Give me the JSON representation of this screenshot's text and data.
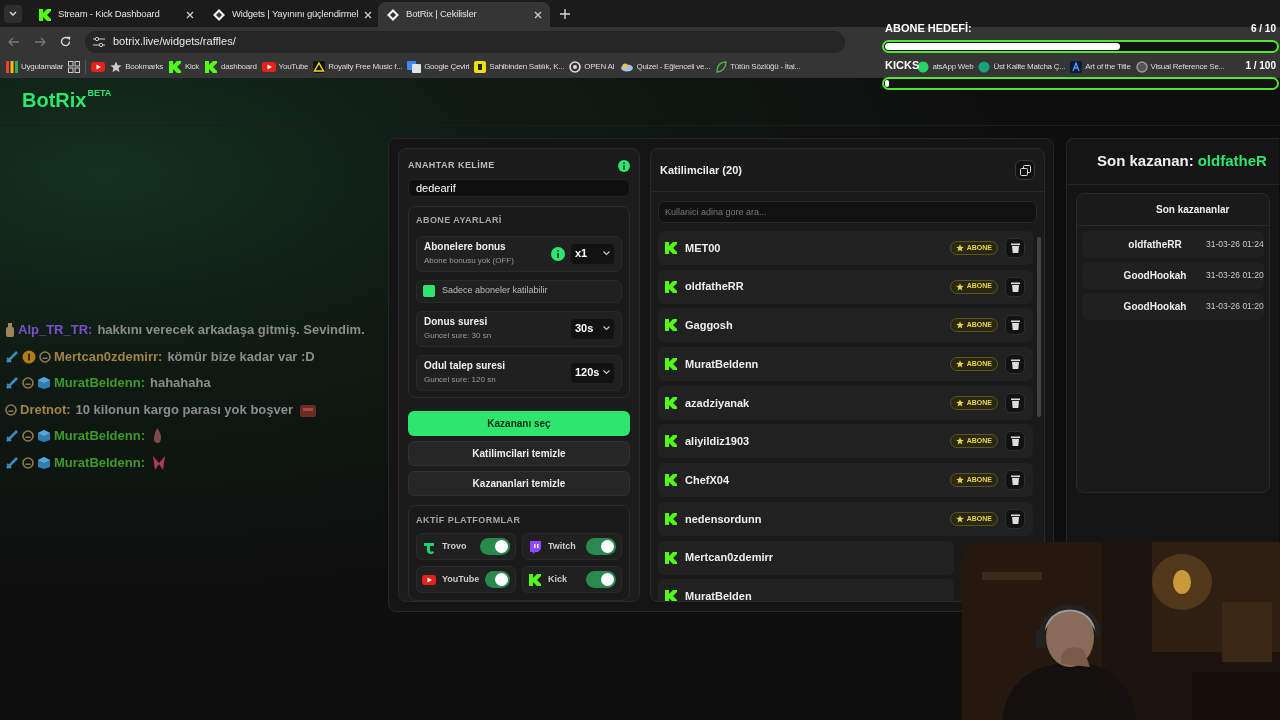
{
  "browser": {
    "tabs": [
      {
        "title": "Stream - Kick Dashboard",
        "kind": "kick",
        "selected": false
      },
      {
        "title": "Widgets | Yayınını güçlendirmel",
        "kind": "botrix",
        "selected": false
      },
      {
        "title": "BotRix | Cekilisler",
        "kind": "botrix",
        "selected": true
      }
    ],
    "url": "botrix.live/widgets/raffles/",
    "bookmarks": [
      {
        "kind": "apps",
        "label": "Uygulamalar"
      },
      {
        "kind": "grid"
      },
      {
        "kind": "youtube"
      },
      {
        "kind": "star",
        "label": "Bookmarks"
      },
      {
        "kind": "kick",
        "label": "Kick"
      },
      {
        "kind": "kick",
        "label": "dashboard"
      },
      {
        "kind": "youtube",
        "label": "YouTube"
      },
      {
        "kind": "triangle",
        "label": "Royalty Free Music f..."
      },
      {
        "kind": "translate",
        "label": "Google Çeviri"
      },
      {
        "kind": "square",
        "label": "Sahibinden Satılık, K..."
      },
      {
        "kind": "openai",
        "label": "OPEN AI"
      },
      {
        "kind": "quiz",
        "label": "Quizei - Eğlenceli ve..."
      },
      {
        "kind": "leaf",
        "label": "Tütün Sözlüğü - İtal..."
      },
      {
        "kind": "chat",
        "label": "atsApp Web"
      },
      {
        "kind": "dot",
        "label": "Üst Kalite Matcha Ç..."
      },
      {
        "kind": "art",
        "label": "Art of the Title"
      },
      {
        "kind": "ring",
        "label": "Visual Reference Se..."
      }
    ]
  },
  "goals": [
    {
      "title": "ABONE HEDEFİ:",
      "count": "6 / 10",
      "level": 0.6
    },
    {
      "title": "KICKS",
      "count": "1 / 100",
      "level": 0.01
    }
  ],
  "logo": {
    "text": "BotRix",
    "badge": "BETA"
  },
  "chat": [
    {
      "user": "Alp_TR_TR:",
      "color": "#7a52cc",
      "badges": [
        {
          "kind": "bottle"
        }
      ],
      "text": "hakkını verecek arkadaşa gitmiş. Sevindim."
    },
    {
      "user": "Mertcan0zdemirr:",
      "color": "#a08446",
      "badges": [
        {
          "kind": "sword"
        },
        {
          "kind": "coin"
        },
        {
          "kind": "face"
        }
      ],
      "text": "kömür bize kadar var :D"
    },
    {
      "user": "MuratBeldenn:",
      "color": "#3d9b2a",
      "badges": [
        {
          "kind": "sword"
        },
        {
          "kind": "face"
        },
        {
          "kind": "cube"
        }
      ],
      "text": "hahahaha"
    },
    {
      "user": "Dretnot:",
      "color": "#a08446",
      "badges": [
        {
          "kind": "face"
        }
      ],
      "text": "10 kilonun kargo parası yok boşver",
      "emotes": [
        {
          "kind": "box"
        }
      ]
    },
    {
      "user": "MuratBeldenn:",
      "color": "#3d9b2a",
      "badges": [
        {
          "kind": "sword"
        },
        {
          "kind": "face"
        },
        {
          "kind": "cube"
        }
      ],
      "emotes": [
        {
          "kind": "drop"
        }
      ]
    },
    {
      "user": "MuratBeldenn:",
      "color": "#3d9b2a",
      "badges": [
        {
          "kind": "sword"
        },
        {
          "kind": "face"
        },
        {
          "kind": "cube"
        }
      ],
      "emotes": [
        {
          "kind": "bow"
        }
      ]
    }
  ],
  "raffle": {
    "keyword_label": "ANAHTAR KELİME",
    "keyword": "dedearif",
    "sub_title": "ABONE AYARLARİ",
    "settings": [
      {
        "kind": "select",
        "title": "Abonelere bonus",
        "hint": "Abone bonusu yok (OFF)",
        "info": true,
        "value": "x1"
      },
      {
        "kind": "checkbox",
        "label": "Sadece aboneler katilabilir",
        "checked": true
      },
      {
        "kind": "select",
        "title": "Donus suresi",
        "hint": "Guncel sure: 30 sn",
        "value": "30s"
      },
      {
        "kind": "select",
        "title": "Odul talep suresi",
        "hint": "Guncel sure: 120 sn",
        "value": "120s"
      }
    ],
    "buttons": [
      {
        "label": "Kazananı seç",
        "primary": true
      },
      {
        "label": "Katilimcilari temizle",
        "primary": false
      },
      {
        "label": "Kazananlari temizle",
        "primary": false
      }
    ],
    "platforms_title": "AKTİF PLATFORMLAR",
    "platforms": [
      {
        "name": "Trovo",
        "kind": "trovo",
        "on": true
      },
      {
        "name": "Twitch",
        "kind": "twitch",
        "on": true
      },
      {
        "name": "YouTube",
        "kind": "youtube",
        "on": true
      },
      {
        "name": "Kick",
        "kind": "kick",
        "on": true
      }
    ]
  },
  "participants": {
    "title": "Katilimcilar (20)",
    "search_placeholder": "Kullanici adina gore ara...",
    "rows": [
      {
        "name": "MET00",
        "badge": "ABONE"
      },
      {
        "name": "oldfatheRR",
        "badge": "ABONE"
      },
      {
        "name": "Gaggosh",
        "badge": "ABONE"
      },
      {
        "name": "MuratBeldenn",
        "badge": "ABONE"
      },
      {
        "name": "azadziyanak",
        "badge": "ABONE"
      },
      {
        "name": "aliyildiz1903",
        "badge": "ABONE"
      },
      {
        "name": "ChefX04",
        "badge": "ABONE"
      },
      {
        "name": "nedensordunn",
        "badge": "ABONE"
      },
      {
        "name": "Mertcan0zdemirr"
      },
      {
        "name": "MuratBelden"
      }
    ]
  },
  "winner": {
    "label": "Son kazanan:",
    "name": "oldfatheR",
    "table_title": "Son kazananlar",
    "rows": [
      {
        "name": "oldfatheRR",
        "time": "31-03-26 01:24"
      },
      {
        "name": "GoodHookah",
        "time": "31-03-26 01:20"
      },
      {
        "name": "GoodHookah",
        "time": "31-03-26 01:20"
      }
    ]
  }
}
